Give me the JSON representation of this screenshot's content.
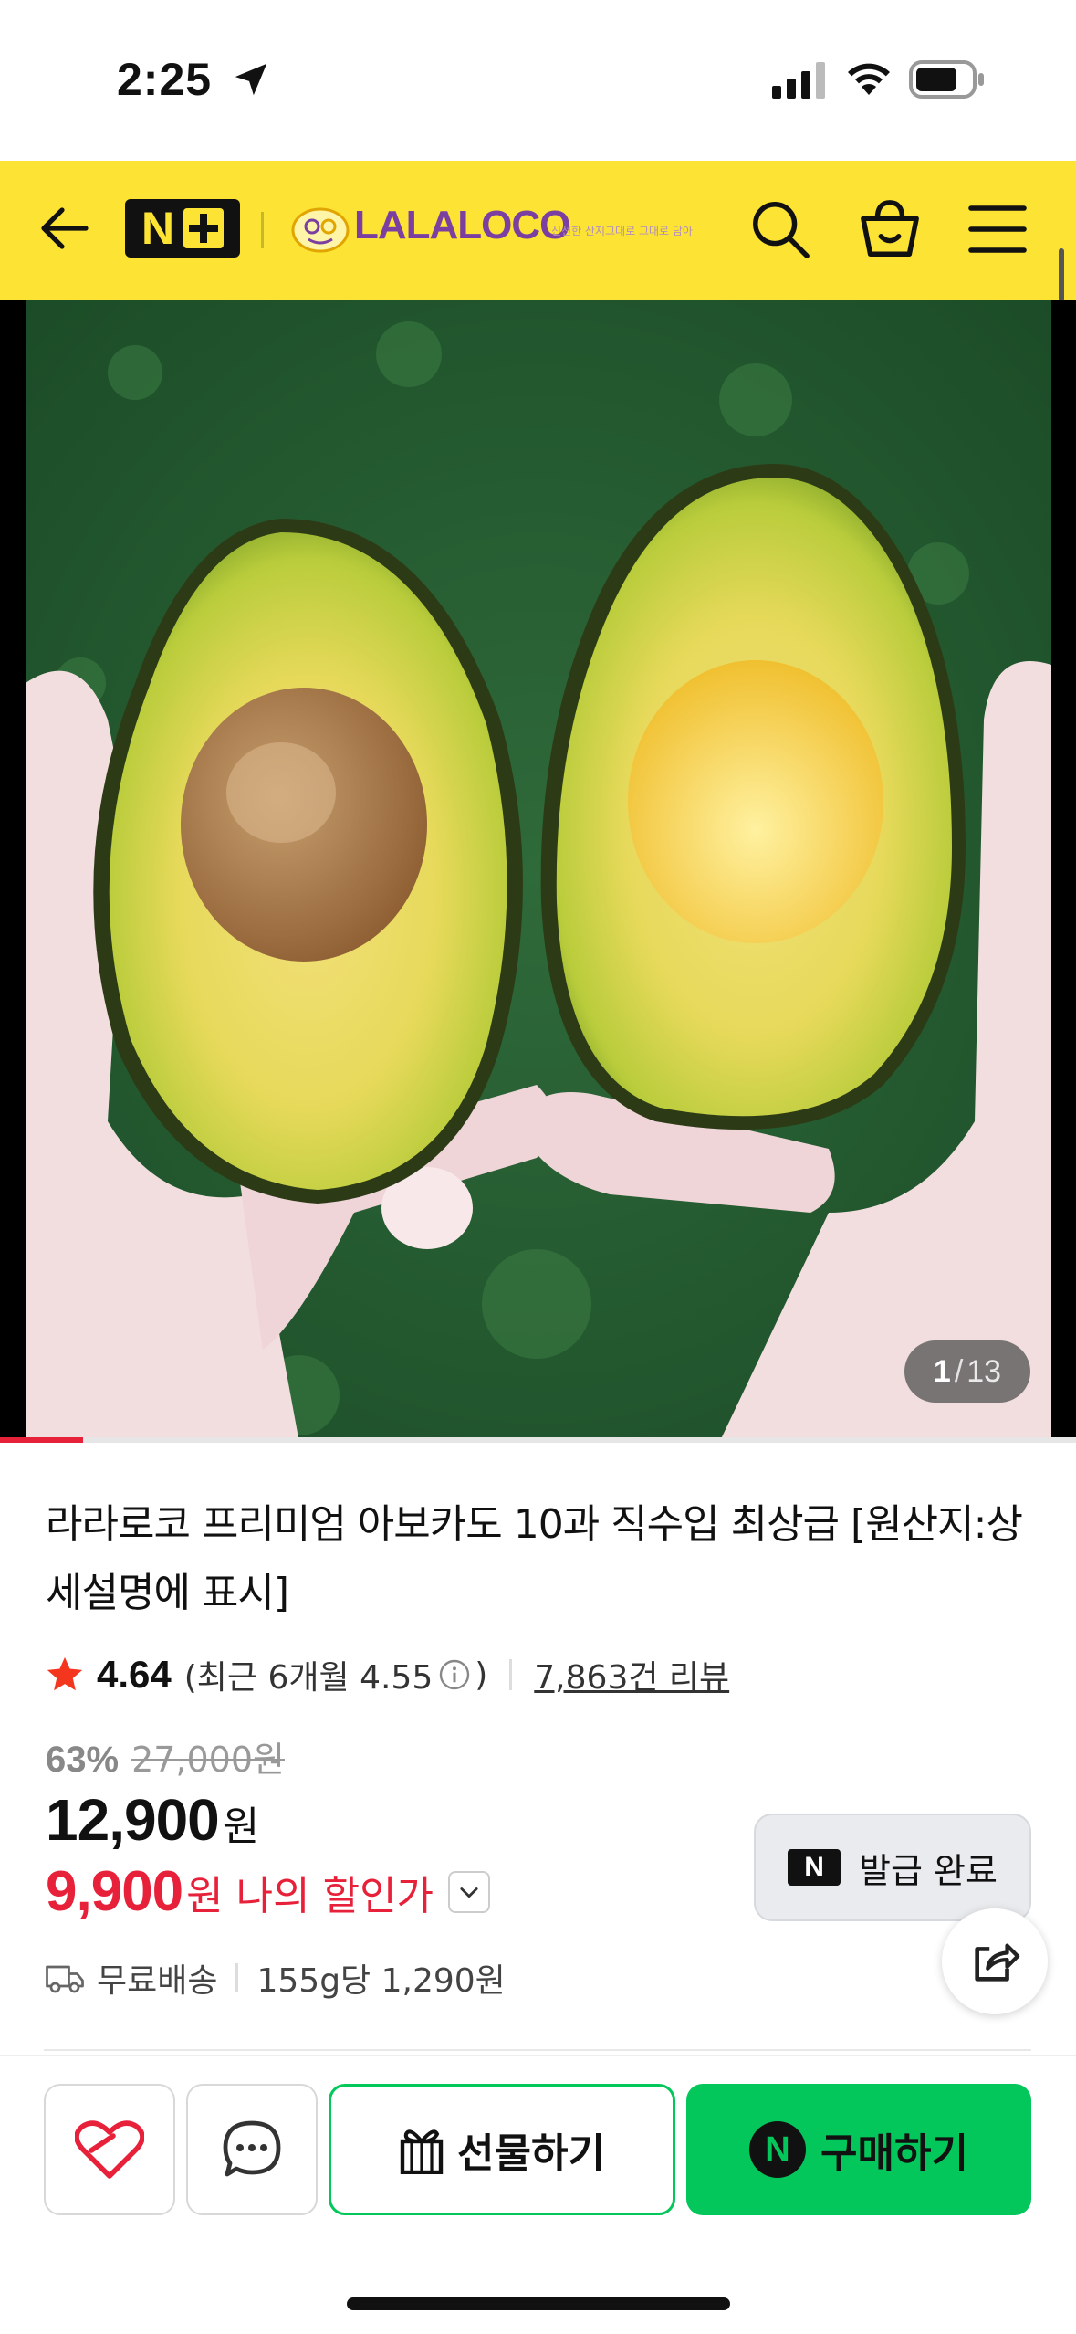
{
  "status_bar": {
    "time": "2:25"
  },
  "header": {
    "logo_text": "N+",
    "brand_name": "LALALOCO",
    "brand_tagline": "신선한 산지그대로 그대로 담아"
  },
  "gallery": {
    "current": "1",
    "separator": "/",
    "total": "13",
    "progress": 0.077
  },
  "product": {
    "title": "라라로코 프리미엄 아보카도 10과 직수입 최상급 [원산지:상세설명에 표시]",
    "rating": {
      "score": "4.64",
      "recent_label": "(최근 6개월 4.55",
      "recent_close": ")",
      "review_count": "7,863건 리뷰"
    },
    "price": {
      "discount_rate": "63%",
      "original": "27,000원",
      "current": "12,900",
      "current_unit": "원",
      "my_discount": "9,900",
      "my_discount_unit": "원",
      "my_discount_label": "나의 할인가"
    },
    "coupon": {
      "badge": "N",
      "label": "발급 완료"
    },
    "delivery": {
      "shipping": "무료배송",
      "unit_price": "155g당 1,290원"
    }
  },
  "bottom_bar": {
    "gift_label": "선물하기",
    "buy_badge": "N",
    "buy_label": "구매하기"
  },
  "colors": {
    "header_bg": "#fde333",
    "brand": "#7a3fa0",
    "accent_red": "#e8213a",
    "naver_green": "#03c75a"
  }
}
